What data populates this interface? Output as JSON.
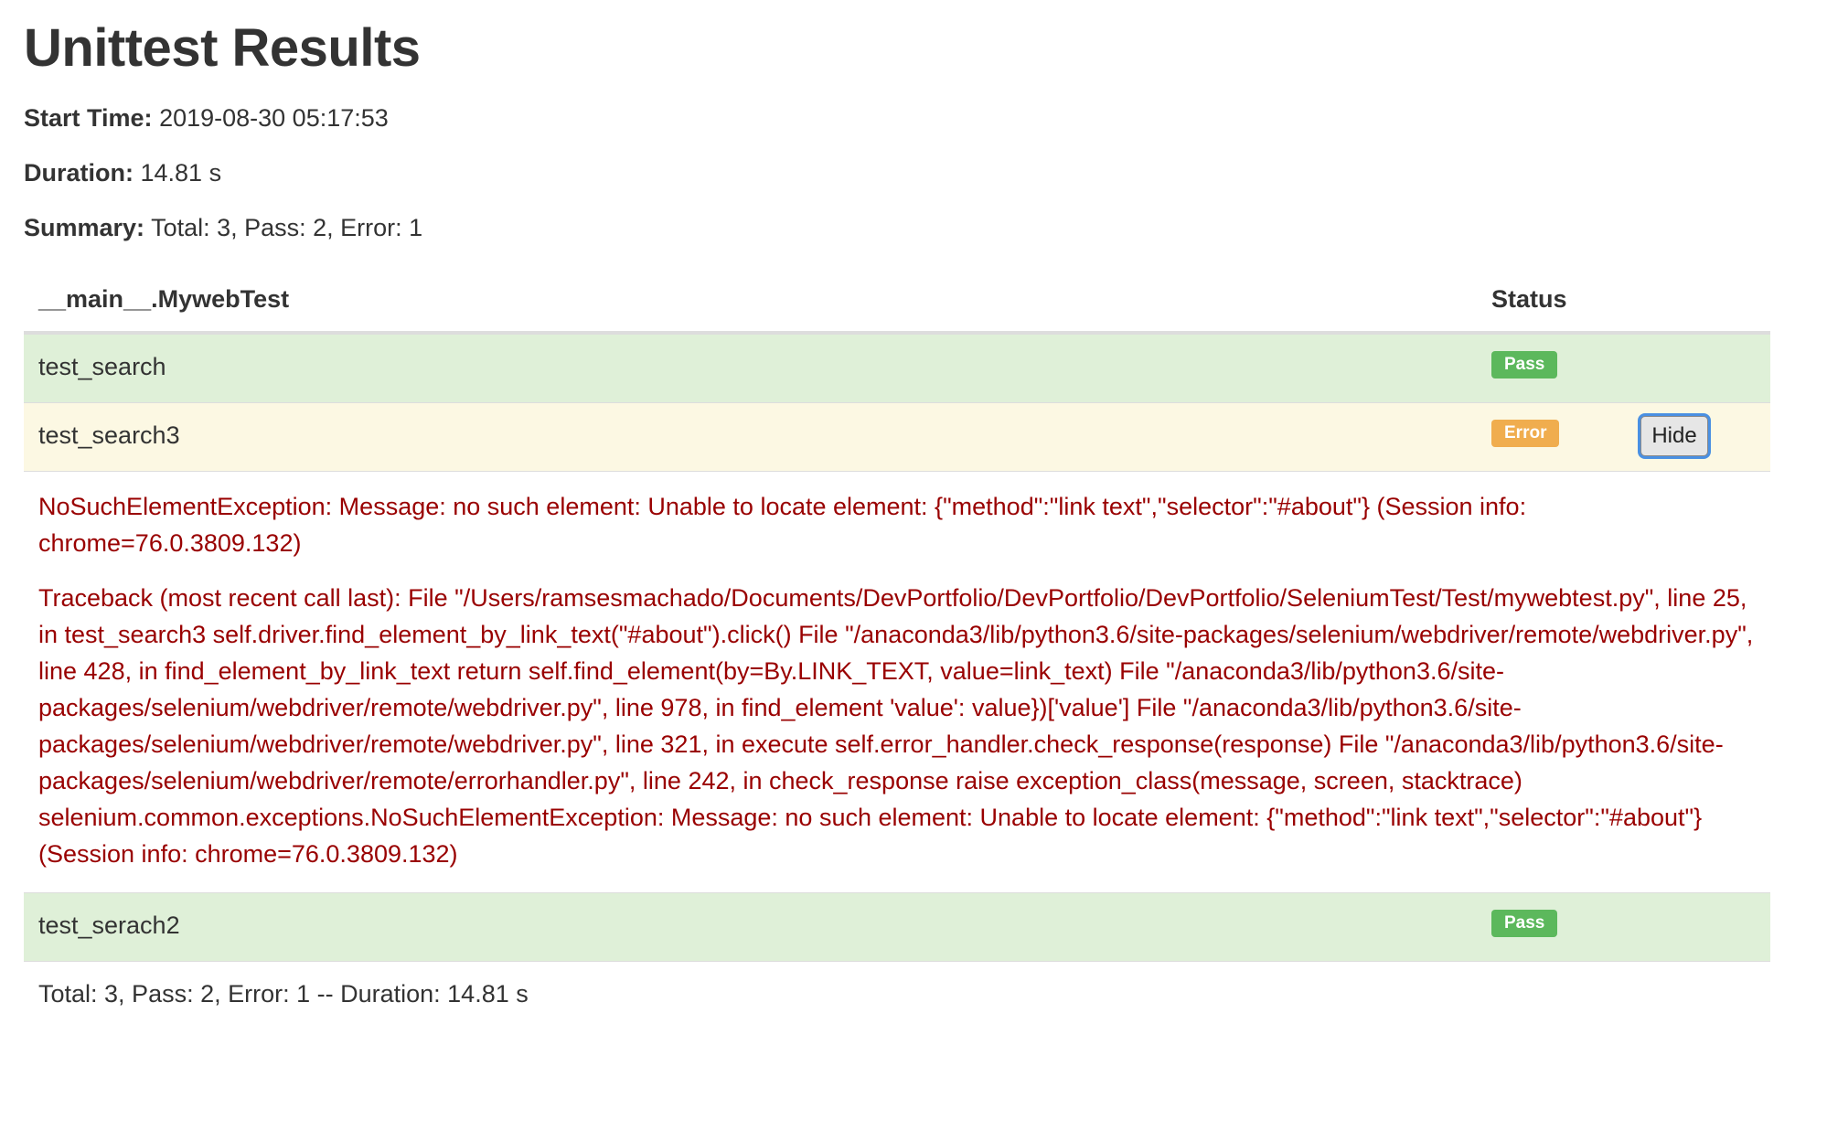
{
  "title": "Unittest Results",
  "meta": {
    "start_label": "Start Time:",
    "start_value": "2019-08-30 05:17:53",
    "duration_label": "Duration:",
    "duration_value": "14.81 s",
    "summary_label": "Summary:",
    "summary_value": "Total: 3, Pass: 2, Error: 1"
  },
  "table": {
    "header_name": "__main__.MywebTest",
    "header_status": "Status",
    "rows": [
      {
        "name": "test_search",
        "status": "Pass"
      },
      {
        "name": "test_search3",
        "status": "Error",
        "button": "Hide"
      },
      {
        "name": "test_serach2",
        "status": "Pass"
      }
    ],
    "error_detail": {
      "message": "NoSuchElementException: Message: no such element: Unable to locate element: {\"method\":\"link text\",\"selector\":\"#about\"} (Session info: chrome=76.0.3809.132)",
      "traceback": "Traceback (most recent call last): File \"/Users/ramsesmachado/Documents/DevPortfolio/DevPortfolio/DevPortfolio/SeleniumTest/Test/mywebtest.py\", line 25, in test_search3 self.driver.find_element_by_link_text(\"#about\").click() File \"/anaconda3/lib/python3.6/site-packages/selenium/webdriver/remote/webdriver.py\", line 428, in find_element_by_link_text return self.find_element(by=By.LINK_TEXT, value=link_text) File \"/anaconda3/lib/python3.6/site-packages/selenium/webdriver/remote/webdriver.py\", line 978, in find_element 'value': value})['value'] File \"/anaconda3/lib/python3.6/site-packages/selenium/webdriver/remote/webdriver.py\", line 321, in execute self.error_handler.check_response(response) File \"/anaconda3/lib/python3.6/site-packages/selenium/webdriver/remote/errorhandler.py\", line 242, in check_response raise exception_class(message, screen, stacktrace) selenium.common.exceptions.NoSuchElementException: Message: no such element: Unable to locate element: {\"method\":\"link text\",\"selector\":\"#about\"} (Session info: chrome=76.0.3809.132)"
    },
    "total_line": "Total: 3, Pass: 2, Error: 1 -- Duration: 14.81 s"
  },
  "colors": {
    "pass_row": "#dff0d8",
    "error_row": "#fcf8e3",
    "pass_badge": "#5cb85c",
    "error_badge": "#f0ad4e",
    "error_text": "#990000"
  }
}
